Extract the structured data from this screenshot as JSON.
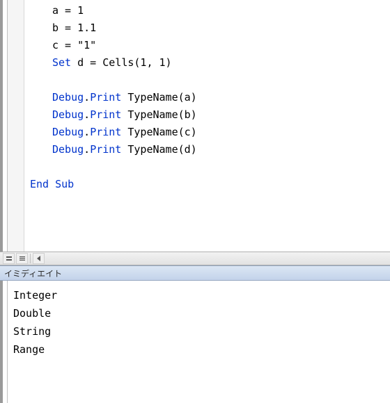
{
  "code": {
    "lines": [
      {
        "indent": 1,
        "segments": [
          {
            "t": "a = 1",
            "c": "txt"
          }
        ]
      },
      {
        "indent": 1,
        "segments": [
          {
            "t": "b = 1.1",
            "c": "txt"
          }
        ]
      },
      {
        "indent": 1,
        "segments": [
          {
            "t": "c = \"1\"",
            "c": "txt"
          }
        ]
      },
      {
        "indent": 1,
        "segments": [
          {
            "t": "Set",
            "c": "kw"
          },
          {
            "t": " d = Cells(1, 1)",
            "c": "txt"
          }
        ]
      },
      {
        "indent": 1,
        "segments": []
      },
      {
        "indent": 1,
        "segments": [
          {
            "t": "Debug",
            "c": "kw"
          },
          {
            "t": ".",
            "c": "txt"
          },
          {
            "t": "Print",
            "c": "kw"
          },
          {
            "t": " TypeName(a)",
            "c": "txt"
          }
        ]
      },
      {
        "indent": 1,
        "segments": [
          {
            "t": "Debug",
            "c": "kw"
          },
          {
            "t": ".",
            "c": "txt"
          },
          {
            "t": "Print",
            "c": "kw"
          },
          {
            "t": " TypeName(b)",
            "c": "txt"
          }
        ]
      },
      {
        "indent": 1,
        "segments": [
          {
            "t": "Debug",
            "c": "kw"
          },
          {
            "t": ".",
            "c": "txt"
          },
          {
            "t": "Print",
            "c": "kw"
          },
          {
            "t": " TypeName(c)",
            "c": "txt"
          }
        ]
      },
      {
        "indent": 1,
        "segments": [
          {
            "t": "Debug",
            "c": "kw"
          },
          {
            "t": ".",
            "c": "txt"
          },
          {
            "t": "Print",
            "c": "kw"
          },
          {
            "t": " TypeName(d)",
            "c": "txt"
          }
        ]
      },
      {
        "indent": 1,
        "segments": []
      },
      {
        "indent": 0,
        "segments": [
          {
            "t": "End Sub",
            "c": "kw"
          }
        ]
      }
    ]
  },
  "immediate": {
    "title": "イミディエイト",
    "output": [
      "Integer",
      "Double",
      "String",
      "Range"
    ]
  },
  "toolbar": {
    "btn1": "procedure-view",
    "btn2": "full-module-view",
    "btn3": "scroll-left"
  }
}
